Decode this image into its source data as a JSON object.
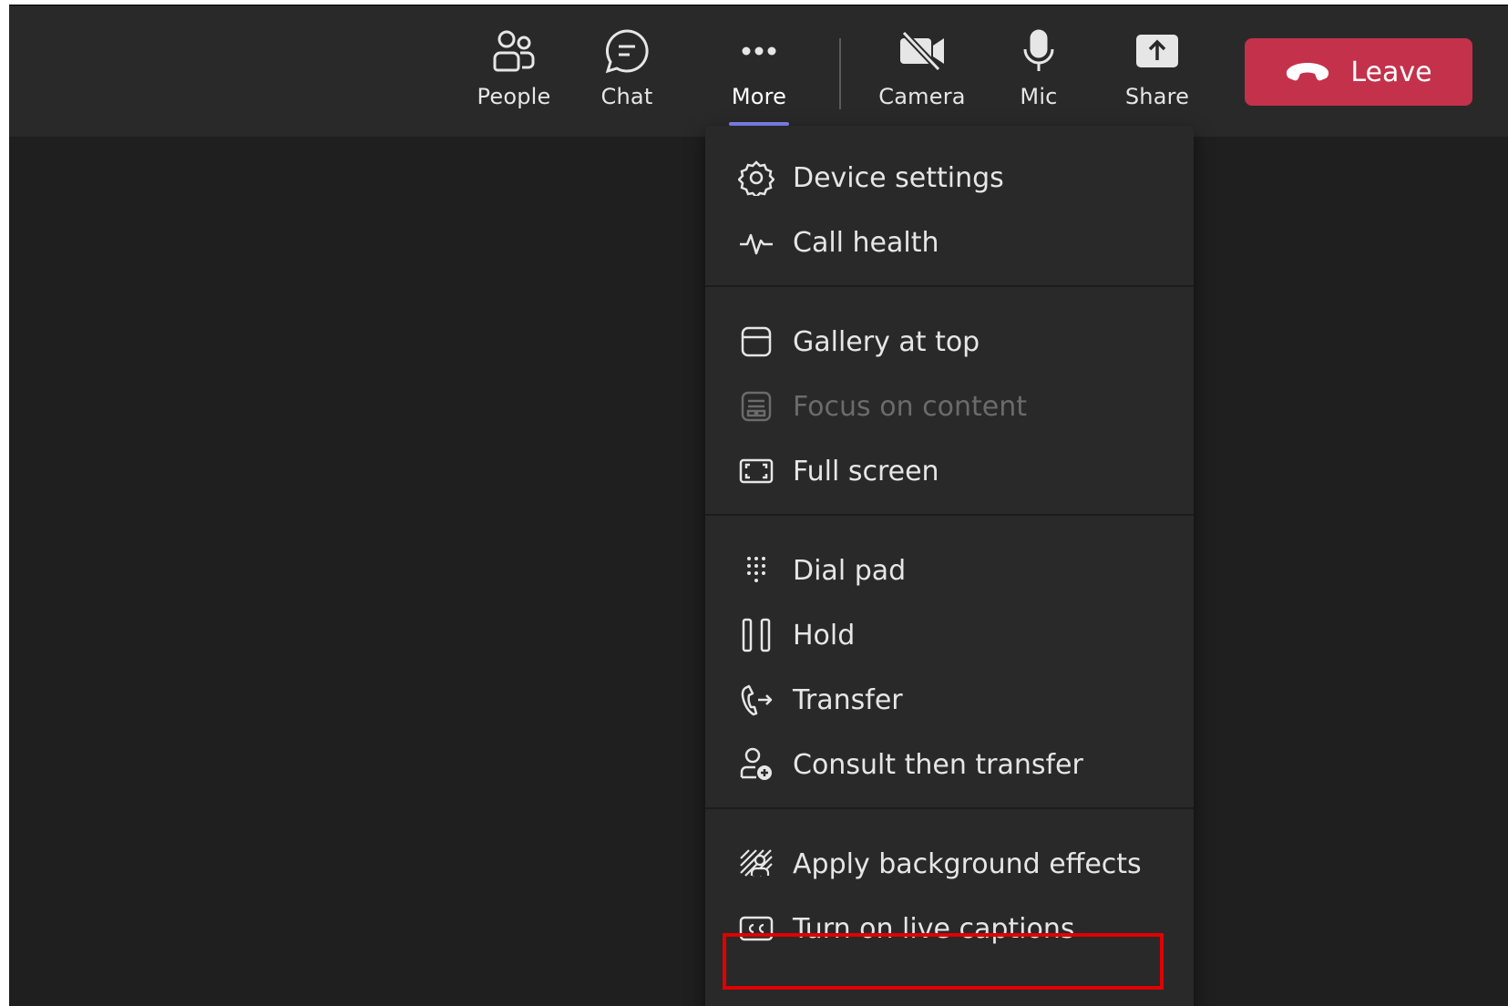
{
  "toolbar": {
    "people_label": "People",
    "chat_label": "Chat",
    "more_label": "More",
    "camera_label": "Camera",
    "mic_label": "Mic",
    "share_label": "Share",
    "leave_label": "Leave"
  },
  "menu": {
    "groups": [
      {
        "items": [
          {
            "label": "Device settings",
            "icon": "gear-icon"
          },
          {
            "label": "Call health",
            "icon": "pulse-icon"
          }
        ]
      },
      {
        "items": [
          {
            "label": "Gallery at top",
            "icon": "gallery-top-icon"
          },
          {
            "label": "Focus on content",
            "icon": "focus-content-icon",
            "disabled": true
          },
          {
            "label": "Full screen",
            "icon": "full-screen-icon"
          }
        ]
      },
      {
        "items": [
          {
            "label": "Dial pad",
            "icon": "dial-pad-icon"
          },
          {
            "label": "Hold",
            "icon": "hold-icon"
          },
          {
            "label": "Transfer",
            "icon": "transfer-icon"
          },
          {
            "label": "Consult then transfer",
            "icon": "consult-transfer-icon"
          }
        ]
      },
      {
        "items": [
          {
            "label": "Apply background effects",
            "icon": "background-effects-icon"
          },
          {
            "label": "Turn on live captions",
            "icon": "captions-icon",
            "highlighted": true
          }
        ]
      }
    ]
  },
  "colors": {
    "leave_button": "#c4314b",
    "menu_background": "#292929",
    "app_background": "#1f1f1f",
    "highlight_box": "#e00000",
    "active_underline": "#7f85f5"
  }
}
